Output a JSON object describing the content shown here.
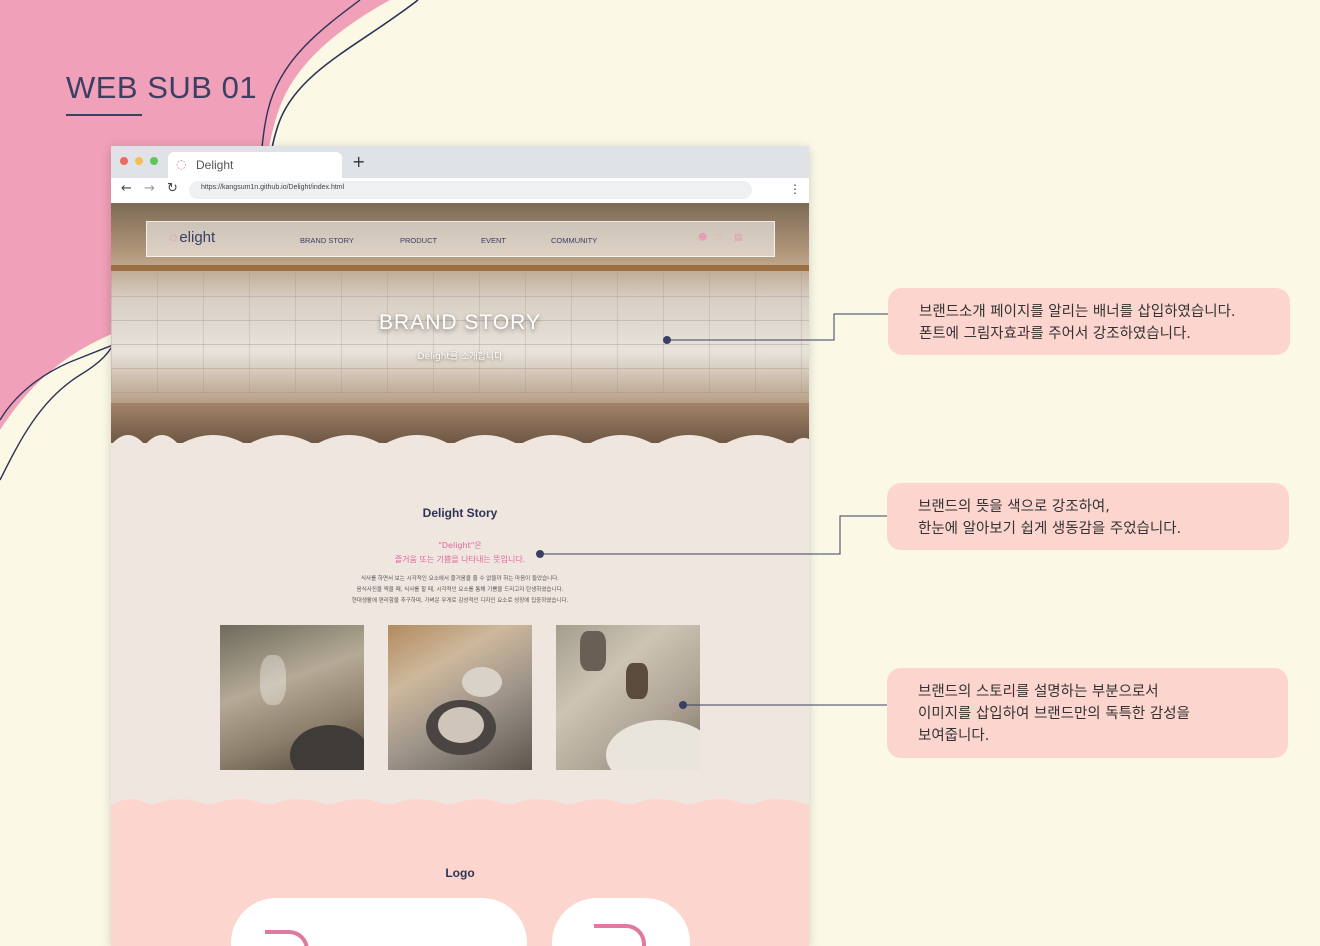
{
  "page": {
    "heading": "WEB SUB 01"
  },
  "browser": {
    "tab_title": "Delight",
    "new_tab": "+",
    "url": "https://kangsum1n.github.io/Delight/index.html",
    "back": "←",
    "forward": "→",
    "reload": "↻",
    "menu": "⋮",
    "window_buttons": [
      "#ed6a5e",
      "#f5bf4f",
      "#61c554"
    ]
  },
  "site": {
    "logo": "elight",
    "nav": [
      "BRAND STORY",
      "PRODUCT",
      "EVENT",
      "COMMUNITY"
    ],
    "hero_title": "BRAND STORY",
    "hero_subtitle": "Delight를 소개합니다",
    "story": {
      "title": "Delight Story",
      "meaning_line1": "\"Delight\"은",
      "meaning_line2": "즐거움 또는 기쁨을 나타내는 뜻입니다.",
      "body_line1": "식사를 하면서 보는 시각적인 요소에서 즐거움을 줄 수 없을까 하는 마음이 들었습니다.",
      "body_line2": "음식사진을 찍을 때, 식사를 할 때, 시각적인 요소를 통해 기쁨을 드리고자 탄생하였습니다.",
      "body_line3": "현대생활에 편리함을 추구하며, 가벼운 무게로 감성적인 디자인 요소로 성장에 집중하였습니다."
    },
    "logo_section_title": "Logo"
  },
  "annotations": [
    {
      "line1": "브랜드소개 페이지를 알리는 배너를 삽입하였습니다.",
      "line2": "폰트에 그림자효과를 주어서 강조하였습니다."
    },
    {
      "line1": "브랜드의 뜻을 색으로 강조하여,",
      "line2": "한눈에 알아보기 쉽게 생동감을 주었습니다."
    },
    {
      "line1": "브랜드의 스토리를 설명하는 부분으로서",
      "line2": "이미지를 삽입하여 브랜드만의 독특한 감성을",
      "line3": "보여줍니다."
    }
  ],
  "colors": {
    "background": "#fbf9e6",
    "pink": "#f0a0b8",
    "navy": "#3a3f63",
    "callout": "#fcd5cf",
    "accent": "#e5659a"
  },
  "icons": [
    "user-icon",
    "heart-icon",
    "cart-icon",
    "delight-logo-mark"
  ]
}
